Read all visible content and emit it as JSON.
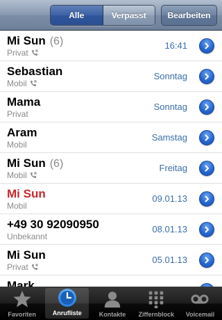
{
  "navbar": {
    "segment_all": "Alle",
    "segment_missed": "Verpasst",
    "edit_label": "Bearbeiten"
  },
  "calls": [
    {
      "name": "Mi Sun",
      "count": "(6)",
      "type": "Privat",
      "outgoing_icon": true,
      "date": "16:41",
      "missed": false
    },
    {
      "name": "Sebastian",
      "count": "",
      "type": "Mobil",
      "outgoing_icon": true,
      "date": "Sonntag",
      "missed": false
    },
    {
      "name": "Mama",
      "count": "",
      "type": "Privat",
      "outgoing_icon": false,
      "date": "Sonntag",
      "missed": false
    },
    {
      "name": "Aram",
      "count": "",
      "type": "Mobil",
      "outgoing_icon": false,
      "date": "Samstag",
      "missed": false
    },
    {
      "name": "Mi Sun",
      "count": "(6)",
      "type": "Mobil",
      "outgoing_icon": true,
      "date": "Freitag",
      "missed": false
    },
    {
      "name": "Mi Sun",
      "count": "",
      "type": "Mobil",
      "outgoing_icon": false,
      "date": "09.01.13",
      "missed": true
    },
    {
      "name": "+49 30 92090950",
      "count": "",
      "type": "Unbekannt",
      "outgoing_icon": false,
      "date": "08.01.13",
      "missed": false
    },
    {
      "name": "Mi Sun",
      "count": "",
      "type": "Privat",
      "outgoing_icon": true,
      "date": "05.01.13",
      "missed": false
    },
    {
      "name": "Mark",
      "count": "",
      "type": "",
      "outgoing_icon": false,
      "date": "",
      "missed": false
    }
  ],
  "tabs": [
    {
      "label": "Favoriten",
      "icon": "star-icon",
      "active": false
    },
    {
      "label": "Anrufliste",
      "icon": "clock-icon",
      "active": true
    },
    {
      "label": "Kontakte",
      "icon": "contacts-icon",
      "active": false
    },
    {
      "label": "Ziffernblock",
      "icon": "keypad-icon",
      "active": false
    },
    {
      "label": "Voicemail",
      "icon": "voicemail-icon",
      "active": false
    }
  ],
  "colors": {
    "missed": "#c8282a",
    "date": "#3a6ea8",
    "accent_blue": "#2767d1"
  }
}
